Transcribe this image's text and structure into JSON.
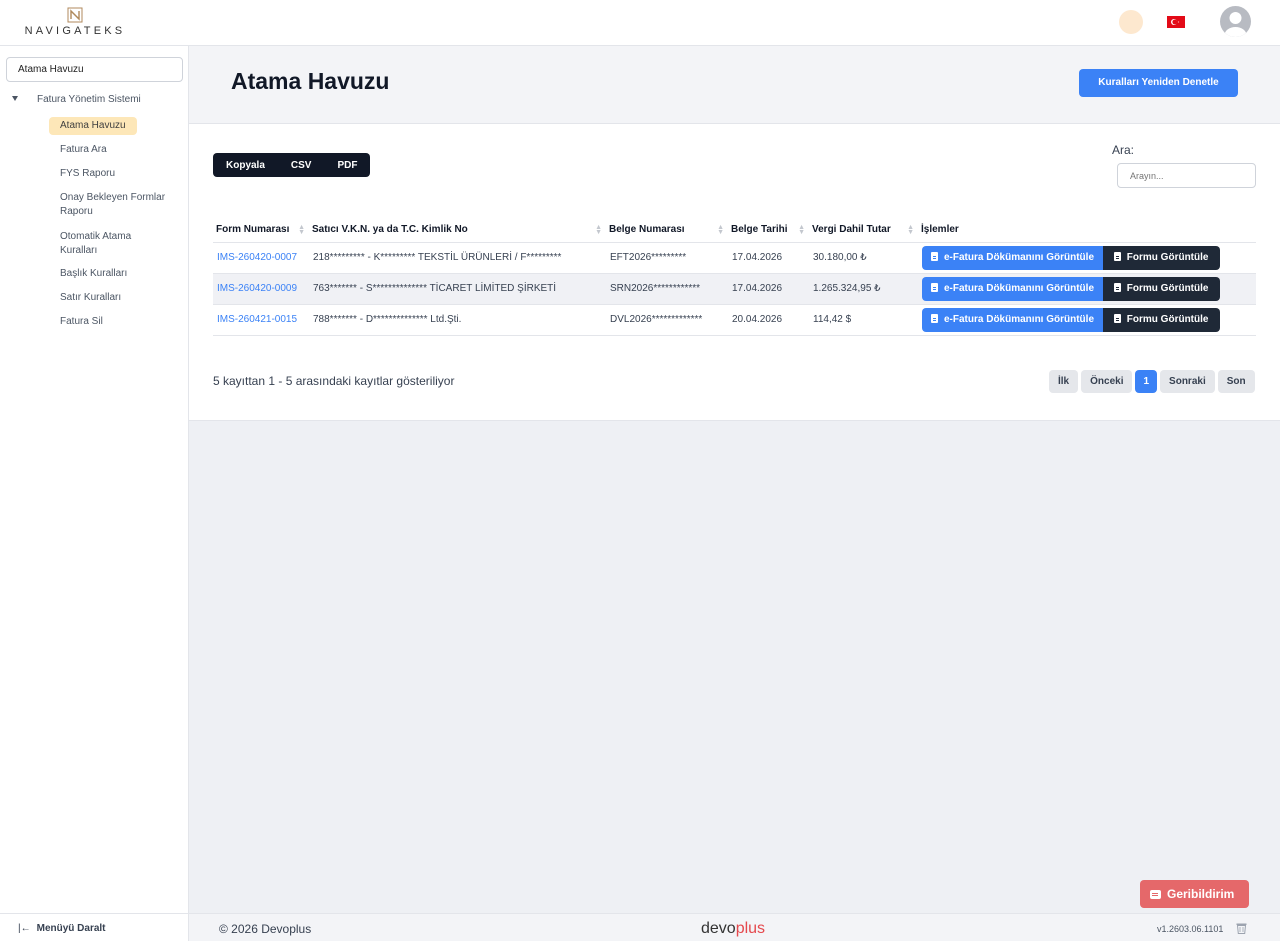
{
  "header": {
    "logo_text": "NAVIGATEKS",
    "language": "Türkçe"
  },
  "sidebar": {
    "search_value": "Atama Havuzu",
    "root_label": "Fatura Yönetim Sistemi",
    "items": [
      {
        "label": "Atama Havuzu",
        "active": true
      },
      {
        "label": "Fatura Ara"
      },
      {
        "label": "FYS Raporu"
      },
      {
        "label": "Onay Bekleyen Formlar Raporu"
      },
      {
        "label": "Otomatik Atama Kuralları"
      },
      {
        "label": "Başlık Kuralları"
      },
      {
        "label": "Satır Kuralları"
      },
      {
        "label": "Fatura Sil"
      }
    ],
    "collapse_label": "Menüyü Daralt"
  },
  "page": {
    "title": "Atama Havuzu",
    "recheck_button": "Kuralları Yeniden Denetle"
  },
  "toolbar": {
    "copy": "Kopyala",
    "csv": "CSV",
    "pdf": "PDF",
    "search_label": "Ara:",
    "search_placeholder": "Arayın..."
  },
  "table": {
    "columns": [
      "Form Numarası",
      "Satıcı V.K.N. ya da T.C. Kimlik No",
      "Belge Numarası",
      "Belge Tarihi",
      "Vergi Dahil Tutar",
      "İşlemler"
    ],
    "rows": [
      {
        "form_no": "IMS-260420-0007",
        "seller": "218********* - K********* TEKSTİL ÜRÜNLERİ / F*********",
        "doc_no": "EFT2026*********",
        "date": "17.04.2026",
        "amount": "30.180,00 ₺"
      },
      {
        "form_no": "IMS-260420-0009",
        "seller": "763******* - S************** TİCARET LİMİTED ŞİRKETİ",
        "doc_no": "SRN2026************",
        "date": "17.04.2026",
        "amount": "1.265.324,95 ₺"
      },
      {
        "form_no": "IMS-260421-0015",
        "seller": "788******* - D************** Ltd.Şti.",
        "doc_no": "DVL2026*************",
        "date": "20.04.2026",
        "amount": "114,42 $"
      }
    ],
    "efatura_button": "e-Fatura Dökümanını Görüntüle",
    "form_button": "Formu Görüntüle"
  },
  "info_text": "5 kayıttan 1 - 5 arasındaki kayıtlar gösteriliyor",
  "pagination": {
    "first": "İlk",
    "prev": "Önceki",
    "current": "1",
    "next": "Sonraki",
    "last": "Son"
  },
  "footer": {
    "copyright": "© 2026 Devoplus",
    "brand_a": "devo",
    "brand_b": "plus",
    "version": "v1.2603.06.1101"
  },
  "feedback_button": "Geribildirim",
  "colors": {
    "primary": "#3b82f6",
    "dark": "#1f2937",
    "feedback": "#e5686a",
    "active_item": "#fde7b8"
  }
}
